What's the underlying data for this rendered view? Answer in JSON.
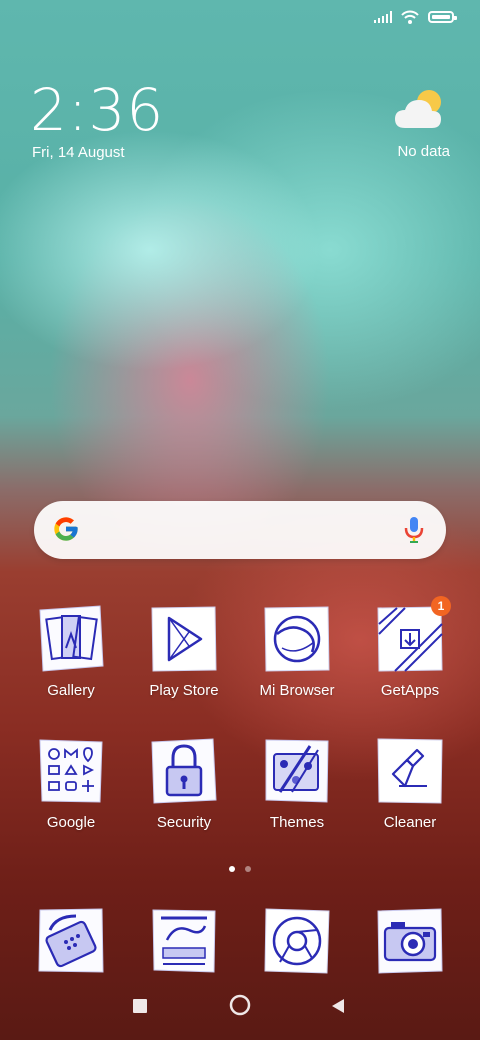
{
  "status_bar": {
    "signal_icon": "signal-icon",
    "wifi_icon": "wifi-icon",
    "battery_icon": "battery-icon"
  },
  "lock_widget": {
    "time": "2:36",
    "date": "Fri, 14 August",
    "weather_icon": "partly-cloudy-icon",
    "weather_text": "No data"
  },
  "search_bar": {
    "logo": "google-g-icon",
    "mic": "mic-icon"
  },
  "apps": {
    "gallery": {
      "label": "Gallery"
    },
    "play_store": {
      "label": "Play Store"
    },
    "mi_browser": {
      "label": "Mi Browser"
    },
    "getapps": {
      "label": "GetApps",
      "badge": "1"
    },
    "google": {
      "label": "Google"
    },
    "security": {
      "label": "Security"
    },
    "themes": {
      "label": "Themes"
    },
    "cleaner": {
      "label": "Cleaner"
    }
  },
  "dock": [
    "phone-icon",
    "messages-icon",
    "chrome-icon",
    "camera-icon"
  ],
  "page_indicator": {
    "pages": 2,
    "current": 1
  },
  "nav_bar": [
    "recents-button",
    "home-button",
    "back-button"
  ],
  "colors": {
    "icon_ink": "#2b2bb5",
    "badge": "#f26522"
  }
}
